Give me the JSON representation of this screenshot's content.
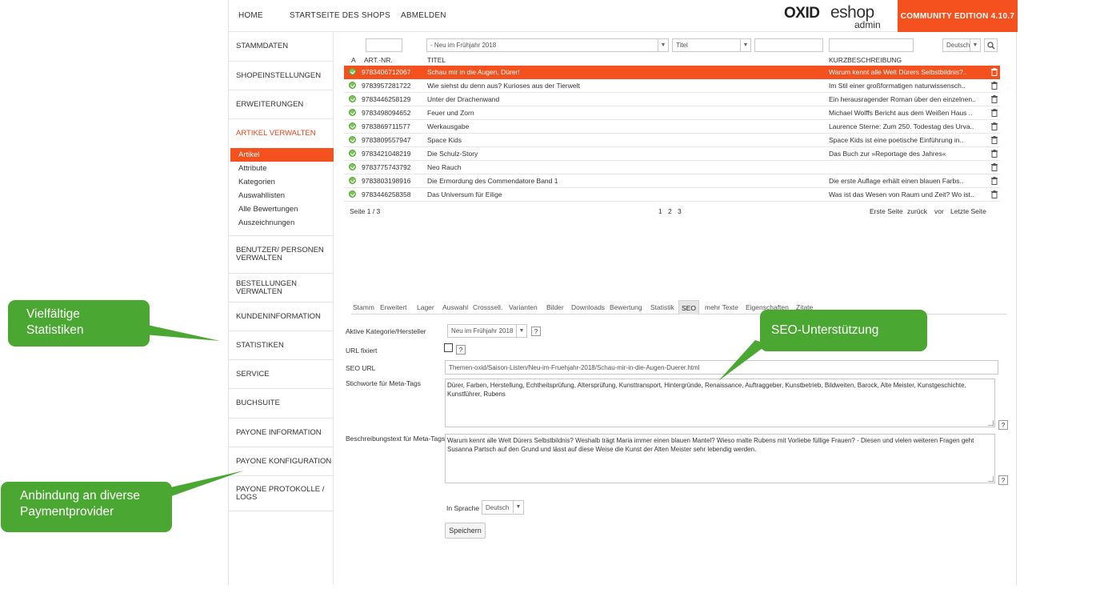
{
  "topnav": {
    "home": "HOME",
    "shop_start": "STARTSEITE DES SHOPS",
    "logout": "ABMELDEN",
    "logo_oxid": "OXID",
    "logo_eshop": "eshop",
    "logo_admin": "admin",
    "edition": "COMMUNITY EDITION 4.10.7",
    "accent_color": "#f4511e"
  },
  "sidebar": {
    "sections": [
      {
        "label": "STAMMDATEN"
      },
      {
        "label": "SHOPEINSTELLUNGEN"
      },
      {
        "label": "ERWEITERUNGEN"
      },
      {
        "label": "ARTIKEL VERWALTEN"
      },
      {
        "label": "BENUTZER/ PERSONEN VERWALTEN"
      },
      {
        "label": "BESTELLUNGEN VERWALTEN"
      },
      {
        "label": "KUNDENINFORMATION"
      },
      {
        "label": "STATISTIKEN"
      },
      {
        "label": "SERVICE"
      },
      {
        "label": "BUCHSUITE"
      },
      {
        "label": "PAYONE INFORMATION"
      },
      {
        "label": "PAYONE KONFIGURATION"
      },
      {
        "label": "PAYONE PROTOKOLLE / LOGS"
      }
    ],
    "subitems": [
      {
        "label": "Artikel"
      },
      {
        "label": "Attribute"
      },
      {
        "label": "Kategorien"
      },
      {
        "label": "Auswahllisten"
      },
      {
        "label": "Alle Bewertungen"
      },
      {
        "label": "Auszeichnungen"
      }
    ]
  },
  "filters": {
    "category": "- Neu im Frühjahr 2018",
    "field": "Titel",
    "language": "Deutsch"
  },
  "columns": {
    "active": "A",
    "artnum": "ART.-NR.",
    "title": "TITEL",
    "shortdesc": "KURZBESCHREIBUNG"
  },
  "articles": [
    {
      "artnum": "9783406712067",
      "title": "Schau mir in die Augen, Dürer!",
      "shortdesc": "Warum kennt alle Welt Dürers Selbstbildnis?.."
    },
    {
      "artnum": "9783957281722",
      "title": "Wie siehst du denn aus? Kurioses aus der Tierwelt",
      "shortdesc": "Im Stil einer großformatigen naturwissensch.."
    },
    {
      "artnum": "9783446258129",
      "title": "Unter der Drachenwand",
      "shortdesc": "Ein herausragender Roman über den einzelnen.."
    },
    {
      "artnum": "9783498094652",
      "title": "Feuer und Zorn",
      "shortdesc": "Michael Wolffs Bericht aus dem Weißen Haus .."
    },
    {
      "artnum": "9783869711577",
      "title": "Werkausgabe",
      "shortdesc": "Laurence Sterne: Zum 250. Todestag des Urva.."
    },
    {
      "artnum": "9783809557947",
      "title": "Space Kids",
      "shortdesc": "Space Kids ist eine poetische Einführung in.."
    },
    {
      "artnum": "9783421048219",
      "title": "Die Schulz-Story",
      "shortdesc": "Das Buch zur »Reportage des Jahres«"
    },
    {
      "artnum": "9783775743792",
      "title": "Neo Rauch",
      "shortdesc": ""
    },
    {
      "artnum": "9783803198916",
      "title": "Die Ermordung des Commendatore Band 1",
      "shortdesc": "Die erste Auflage erhält einen blauen Farbs.."
    },
    {
      "artnum": "9783446258358",
      "title": "Das Universum für Eilige",
      "shortdesc": "Was ist das Wesen von Raum und Zeit? Wo ist.."
    }
  ],
  "pager": {
    "page": "Seite 1 / 3",
    "p1": "1",
    "p2": "2",
    "p3": "3",
    "first": "Erste Seite",
    "back": "zurück",
    "forward": "vor",
    "last": "Letzte Seite"
  },
  "tabs": [
    {
      "label": "Stamm"
    },
    {
      "label": "Erweitert"
    },
    {
      "label": "Lager"
    },
    {
      "label": "Auswahl"
    },
    {
      "label": "Crosssell."
    },
    {
      "label": "Varianten"
    },
    {
      "label": "Bilder"
    },
    {
      "label": "Downloads"
    },
    {
      "label": "Bewertung"
    },
    {
      "label": "Statistik"
    },
    {
      "label": "SEO"
    },
    {
      "label": "mehr Texte"
    },
    {
      "label": "Eigenschaften"
    },
    {
      "label": "Zitate"
    }
  ],
  "seo": {
    "category_label": "Aktive Kategorie/Hersteller",
    "category_value": "Neu im Frühjahr 2018",
    "fixed_label": "URL fixiert",
    "url_label": "SEO URL",
    "url_value": "Themen-oxid/Saison-Listen/Neu-im-Fruehjahr-2018/Schau-mir-in-die-Augen-Duerer.html",
    "keywords_label": "Stichworte für Meta-Tags",
    "keywords_value": "Dürer, Farben, Herstellung, Echtheitsprüfung, Altersprüfung, Kunsttransport, Hintergründe, Renaissance, Auftraggeber, Kunstbetrieb, Bildweiten, Barock, Alte Meister, Kunstgeschichte, Kunstführer, Rubens",
    "desc_label": "Beschreibungstext für Meta-Tags",
    "desc_value": "Warum kennt alle Welt Dürers Selbstbildnis? Weshalb trägt Maria immer einen blauen Mantel? Wieso malte Rubens mit Vorliebe füllige Frauen? - Diesen und vielen weiteren Fragen geht Susanna Partsch auf den Grund und lässt auf diese Weise die Kunst der Alten Meister sehr lebendig werden.",
    "lang_label": "In Sprache",
    "lang_value": "Deutsch",
    "save": "Speichern",
    "help": "?"
  },
  "callouts": {
    "stats": "Vielfältige Statistiken",
    "seo": "SEO-Unterstützung",
    "payment": "Anbindung an diverse Paymentprovider",
    "color": "#4aa832"
  }
}
